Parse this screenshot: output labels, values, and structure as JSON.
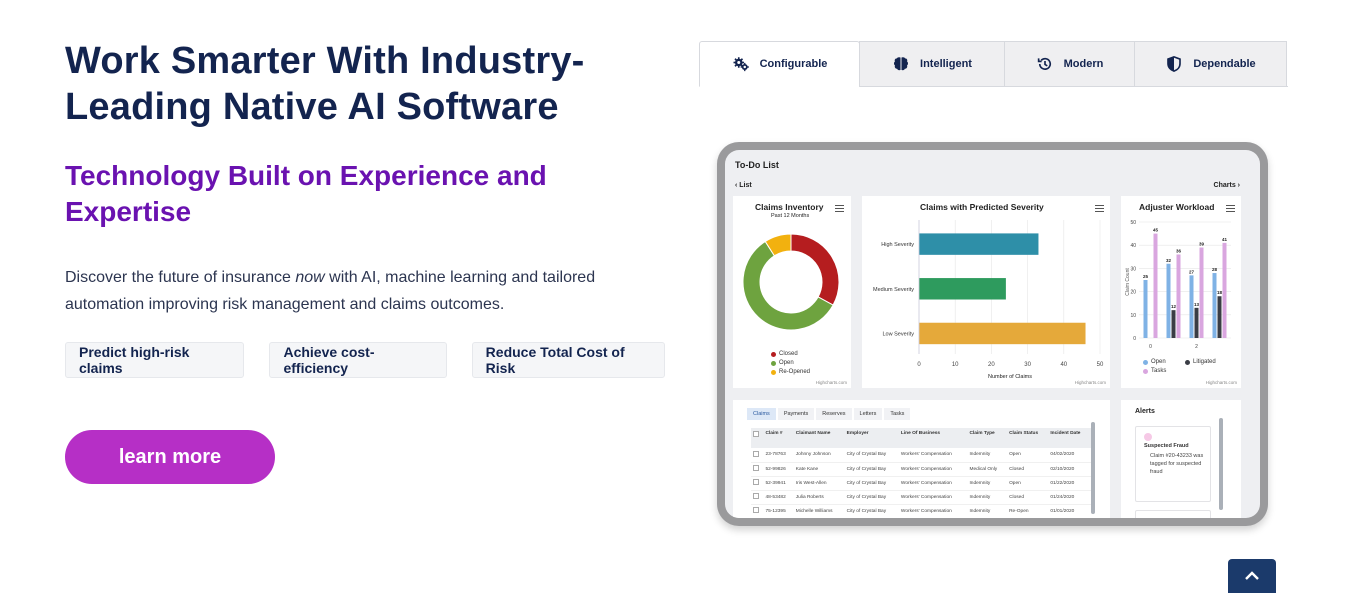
{
  "hero": {
    "headline_line1": "Work Smarter With Industry-",
    "headline_line2": "Leading Native AI Software",
    "subhead_line1": "Technology Built on Experience and",
    "subhead_line2": "Expertise",
    "desc_part1": "Discover the future of insurance ",
    "desc_em": "now",
    "desc_part2": " with AI, machine learning and  tailored automation improving risk management and claims outcomes.",
    "pills": [
      "Predict high-risk claims",
      "Achieve cost-efficiency",
      "Reduce Total Cost of Risk"
    ],
    "cta_label": "learn more"
  },
  "tabs": [
    {
      "label": "Configurable",
      "icon": "gears-icon",
      "active": true
    },
    {
      "label": "Intelligent",
      "icon": "brain-icon",
      "active": false
    },
    {
      "label": "Modern",
      "icon": "history-icon",
      "active": false
    },
    {
      "label": "Dependable",
      "icon": "shield-icon",
      "active": false
    }
  ],
  "dashboard": {
    "title": "To-Do List",
    "list_link": "‹ List",
    "charts_link": "Charts ›",
    "credit": "Highcharts.com",
    "inventory": {
      "title": "Claims Inventory",
      "subtitle": "Past 12 Months",
      "legend": [
        "Closed",
        "Open",
        "Re-Opened"
      ]
    },
    "severity": {
      "title": "Claims with Predicted Severity",
      "xlabel": "Number of Claims",
      "ticks": [
        "0",
        "10",
        "20",
        "30",
        "40",
        "50"
      ]
    },
    "workload": {
      "title": "Adjuster Workload",
      "ylabel": "Claim Count",
      "yticks": [
        "50",
        "40",
        "30",
        "20",
        "10",
        "0"
      ],
      "xticks": [
        "0",
        "2"
      ],
      "legend": [
        "Open",
        "Litigated",
        "Tasks"
      ]
    },
    "claims_table": {
      "tabs": [
        "Claims",
        "Payments",
        "Reserves",
        "Letters",
        "Tasks"
      ],
      "headers": [
        "Claim #",
        "Claimant Name",
        "Employer",
        "Line Of Business",
        "Claim Type",
        "Claim Status",
        "Incident Date"
      ],
      "rows": [
        [
          "23-78763",
          "Johnny Johnson",
          "City of Crystal Bay",
          "Workers' Compensation",
          "Indemnity",
          "Open",
          "04/02/2020"
        ],
        [
          "52-99826",
          "Kate Kane",
          "City of Crystal Bay",
          "Workers' Compensation",
          "Medical Only",
          "Closed",
          "02/10/2020"
        ],
        [
          "52-39941",
          "Iris West-Allen",
          "City of Crystal Bay",
          "Workers' Compensation",
          "Indemnity",
          "Open",
          "01/22/2020"
        ],
        [
          "48-53482",
          "Julia Roberts",
          "City of Crystal Bay",
          "Workers' Compensation",
          "Indemnity",
          "Closed",
          "01/24/2020"
        ],
        [
          "75-12395",
          "Michelle Williams",
          "City of Crystal Bay",
          "Workers' Compensation",
          "Indemnity",
          "Re-Open",
          "01/01/2020"
        ]
      ]
    },
    "alerts": {
      "title": "Alerts",
      "item_title": "Suspected Fraud",
      "item_body": "Claim #20-43233 was tagged for suspected fraud"
    }
  },
  "chart_data": [
    {
      "type": "pie",
      "title": "Claims Inventory",
      "subtitle": "Past 12 Months",
      "categories": [
        "Closed",
        "Open",
        "Re-Opened"
      ],
      "values": [
        33,
        58,
        9
      ],
      "colors": [
        "#b51d1f",
        "#6ea33f",
        "#f2b10f"
      ]
    },
    {
      "type": "bar",
      "title": "Claims with Predicted Severity",
      "categories": [
        "High Severity",
        "Medium Severity",
        "Low Severity"
      ],
      "values": [
        33,
        24,
        46
      ],
      "colors": [
        "#2e8fa8",
        "#2e9b5e",
        "#e5a93a"
      ],
      "xlabel": "Number of Claims",
      "ylim": [
        0,
        50
      ]
    },
    {
      "type": "bar",
      "title": "Adjuster Workload",
      "ylabel": "Claim Count",
      "ylim": [
        0,
        50
      ],
      "categories": [
        "0",
        "1",
        "2",
        "3"
      ],
      "series": [
        {
          "name": "Open",
          "values": [
            25,
            32,
            27,
            28
          ],
          "color": "#7fb2e5"
        },
        {
          "name": "Litigated",
          "values": [
            null,
            12,
            13,
            18
          ],
          "color": "#3a3d45"
        },
        {
          "name": "Tasks",
          "values": [
            45,
            36,
            39,
            41
          ],
          "color": "#d9a6df"
        }
      ]
    }
  ],
  "colors": {
    "headline": "#13244f",
    "subhead": "#6a12b0",
    "cta": "#b62fc6",
    "scroll_top": "#1b3a6b"
  }
}
